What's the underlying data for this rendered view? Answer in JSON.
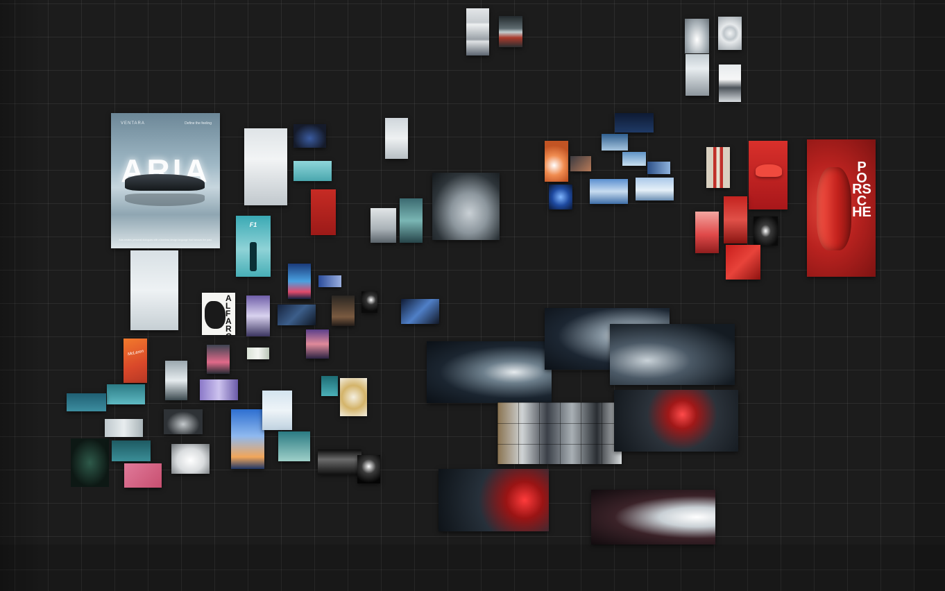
{
  "canvas": {
    "grid_color": "#2a2a2a",
    "background": "#1c1c1c"
  },
  "posters": {
    "aria": {
      "brand": "VENTARA",
      "tag": "Define the feeling",
      "word": "ARIA",
      "footer": "Aria creates personal dialogues with a timeless design language that honours the past."
    },
    "porsche": {
      "word": "PORSCHE"
    },
    "f1": {
      "logo": "F1"
    },
    "alfa": {
      "word": "ALFA ROMEO"
    },
    "mclaren": {
      "text": "McLaren"
    }
  },
  "images": [
    {
      "name": "gallery-thumb-silver-cars",
      "colors": [
        "#d7dce0",
        "#5a6470"
      ]
    },
    {
      "name": "gallery-thumb-sports-duo",
      "colors": [
        "#2a2f33",
        "#c93b2a"
      ]
    },
    {
      "name": "gallery-thumb-white-suv-front",
      "colors": [
        "#a9b2b8",
        "#ffffff"
      ]
    },
    {
      "name": "gallery-thumb-white-tunnel",
      "colors": [
        "#c5cbd0",
        "#8a9298"
      ]
    },
    {
      "name": "gallery-thumb-white-suv-tunnel",
      "colors": [
        "#9aa3aa",
        "#ffffff"
      ]
    },
    {
      "name": "gallery-thumb-white-hypercar",
      "colors": [
        "#e0e4e6",
        "#3b4046"
      ]
    }
  ],
  "accents": {
    "red": "#c2231f",
    "teal": "#3aa9b4",
    "blue": "#2d5b9e",
    "dark": "#151719"
  }
}
